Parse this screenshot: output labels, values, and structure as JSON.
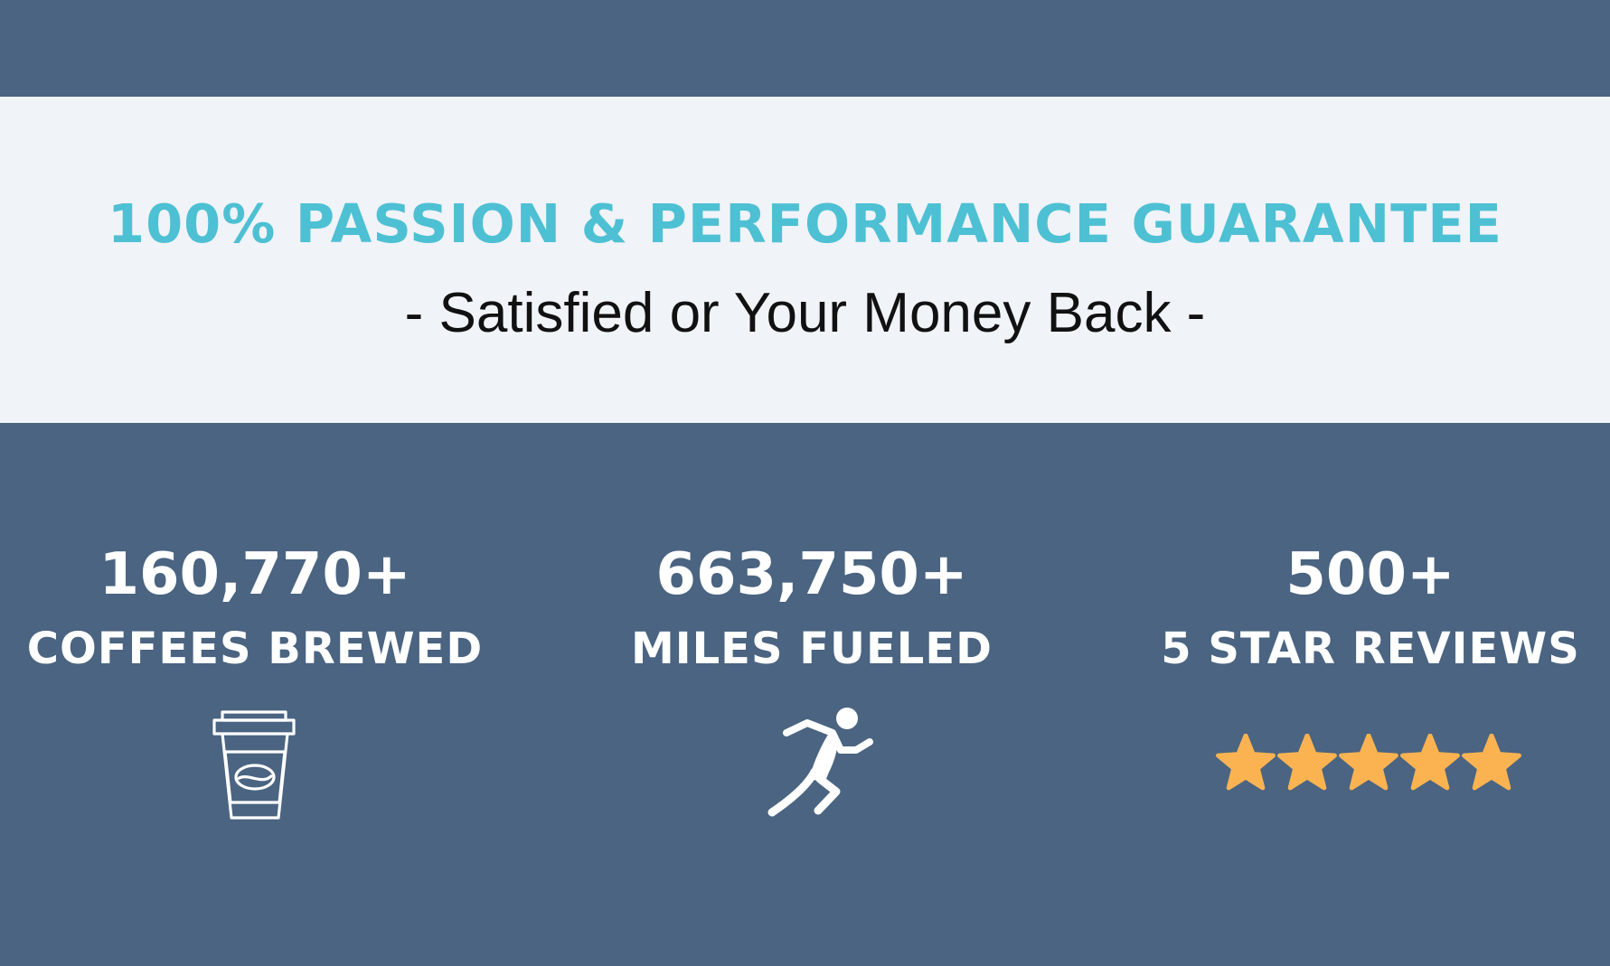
{
  "colors": {
    "background": "#4a6481",
    "band": "#f0f3f8",
    "accent": "#4ec0d3",
    "star": "#fbb352",
    "text_light": "#ffffff",
    "text_dark": "#111111"
  },
  "guarantee": {
    "title": "100% PASSION & PERFORMANCE GUARANTEE",
    "subtitle": "- Satisfied or Your Money Back -"
  },
  "stats": [
    {
      "value": "160,770+",
      "label": "COFFEES BREWED",
      "icon": "coffee-cup-icon"
    },
    {
      "value": "663,750+",
      "label": "MILES FUELED",
      "icon": "runner-icon"
    },
    {
      "value": "500+",
      "label": "5 STAR REVIEWS",
      "icon": "star-icon",
      "rating": 5
    }
  ]
}
